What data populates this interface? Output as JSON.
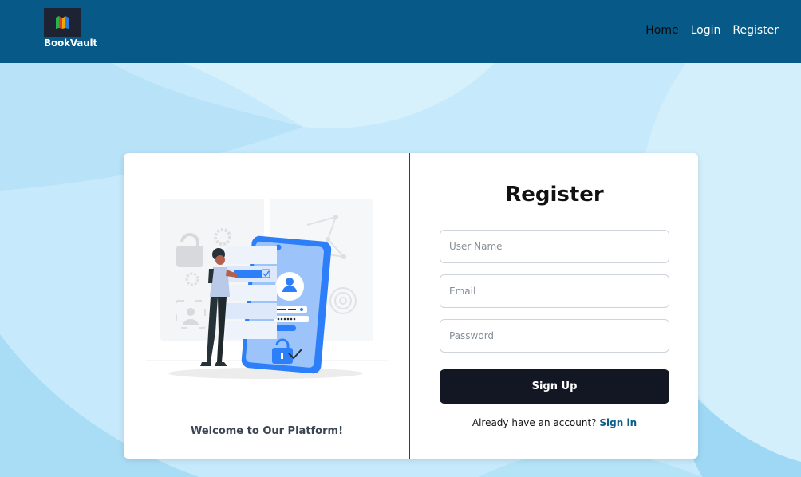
{
  "brand": {
    "name": "BookVault",
    "logo_icon": "book-logo-icon"
  },
  "nav": {
    "home": "Home",
    "login": "Login",
    "register": "Register"
  },
  "illustration": {
    "caption": "Welcome to Our Platform!"
  },
  "form": {
    "title": "Register",
    "username_placeholder": "User Name",
    "email_placeholder": "Email",
    "password_placeholder": "Password",
    "submit_label": "Sign Up",
    "footer_text": "Already have an account?",
    "footer_link": "Sign in"
  },
  "colors": {
    "navbar": "#075987",
    "page_background": "#c9ebfb",
    "button": "#131724",
    "link": "#0b5e8a",
    "illustration_accent": "#2d7ff9"
  }
}
